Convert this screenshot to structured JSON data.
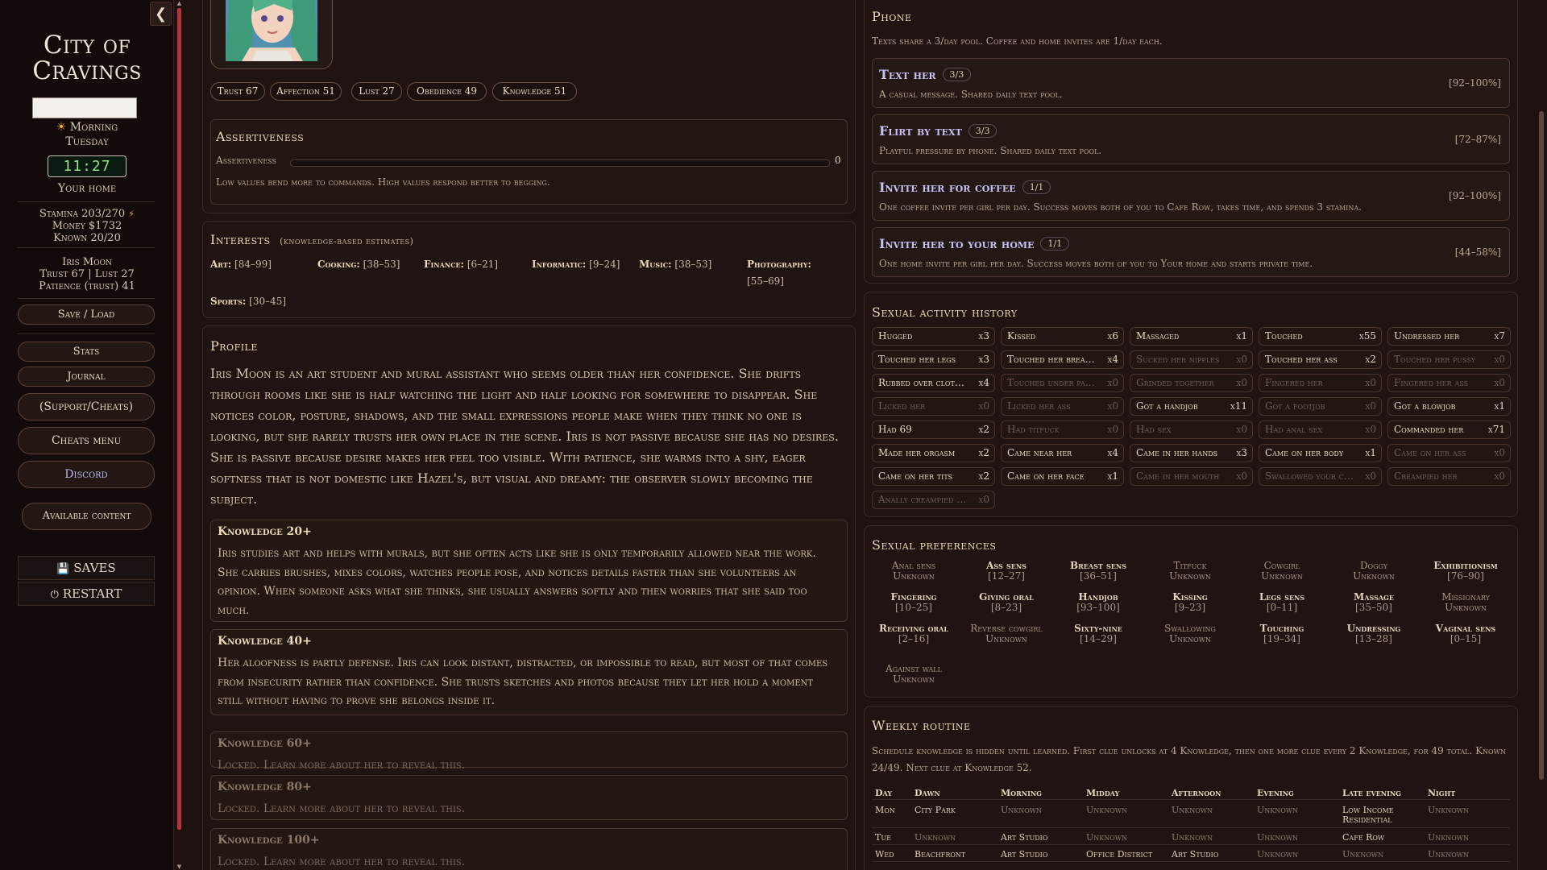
{
  "sidebar": {
    "title_line1": "City of",
    "title_line2": "Cravings",
    "time_of_day": "Morning",
    "day": "Tuesday",
    "clock": "11:27",
    "location": "Your home",
    "stamina": "Stamina 203/270",
    "money": "Money $1732",
    "known": "Known 20/20",
    "girl_name": "Iris Moon",
    "girl_trust_lust": "Trust 67 | Lust 27",
    "girl_patience": "Patience (trust) 41",
    "buttons": {
      "save_load": "Save / Load",
      "stats": "Stats",
      "journal": "Journal",
      "support": "(Support/Cheats)",
      "cheats": "Cheats menu",
      "discord": "Discord",
      "available": "Available content",
      "saves": "SAVES",
      "restart": "RESTART"
    }
  },
  "stats": {
    "trust": "Trust 67",
    "affection": "Affection 51",
    "lust": "Lust 27",
    "obedience": "Obedience 49",
    "knowledge": "Knowledge 51"
  },
  "assertiveness": {
    "title": "Assertiveness",
    "label": "Assertiveness",
    "value": "0",
    "level": 0,
    "desc": "Low values bend more to commands. High values respond better to begging."
  },
  "interests": {
    "title": "Interests",
    "subtitle": "(knowledge-based estimates)",
    "items": [
      {
        "name": "Art:",
        "range": "[84–99]"
      },
      {
        "name": "Cooking:",
        "range": "[38–53]"
      },
      {
        "name": "Finance:",
        "range": "[6–21]"
      },
      {
        "name": "Informatic:",
        "range": "[9–24]"
      },
      {
        "name": "Music:",
        "range": "[38–53]"
      },
      {
        "name": "Photography:",
        "range": "[55–69]"
      },
      {
        "name": "Sports:",
        "range": "[30–45]"
      }
    ]
  },
  "profile": {
    "title": "Profile",
    "text": "Iris Moon is an art student and mural assistant who seems older than her confidence. She drifts through rooms like she is half watching the light and half looking for somewhere to disappear. She notices color, posture, shadows, and the small expressions people make when they think no one is looking, but she rarely trusts her own place in the scene. Iris is not passive because she has no desires. She is passive because desire makes her feel too visible. With patience, she warms into a shy, eager softness that is not domestic like Hazel's, but visual and dreamy: the observer slowly becoming the subject.",
    "knowledge": [
      {
        "title": "Knowledge 20+",
        "text": "Iris studies art and helps with murals, but she often acts like she is only temporarily allowed near the work. She carries brushes, mixes colors, watches people pose, and notices details faster than she volunteers an opinion. When someone asks what she thinks, she usually answers softly and then worries that she said too much."
      },
      {
        "title": "Knowledge 40+",
        "text": "Her aloofness is partly defense. Iris can look distant, distracted, or impossible to read, but most of that comes from insecurity rather than confidence. She trusts sketches and photos because they let her hold a moment still without having to prove she belongs inside it."
      },
      {
        "title": "Knowledge 60+",
        "text": "Locked. Learn more about her to reveal this."
      },
      {
        "title": "Knowledge 80+",
        "text": "Locked. Learn more about her to reveal this."
      },
      {
        "title": "Knowledge 100+",
        "text": "Locked. Learn more about her to reveal this."
      }
    ]
  },
  "phone": {
    "title": "Phone",
    "note": "Texts share a 3/day pool. Coffee and home invites are 1/day each.",
    "actions": [
      {
        "title": "Text her",
        "count": "3/3",
        "desc": "A casual message. Shared daily text pool.",
        "range": "[92–100%]"
      },
      {
        "title": "Flirt by text",
        "count": "3/3",
        "desc": "Playful pressure by phone. Shared daily text pool.",
        "range": "[72–87%]"
      },
      {
        "title": "Invite her for coffee",
        "count": "1/1",
        "desc": "One coffee invite per girl per day. Success moves both of you to Cafe Row, takes time, and spends 3 stamina.",
        "range": "[92–100%]"
      },
      {
        "title": "Invite her to your home",
        "count": "1/1",
        "desc": "One home invite per girl per day. Success moves both of you to Your home and starts private time.",
        "range": "[44–58%]"
      }
    ]
  },
  "history": {
    "title": "Sexual activity history",
    "items": [
      {
        "label": "Hugged",
        "value": "x3"
      },
      {
        "label": "Kissed",
        "value": "x6"
      },
      {
        "label": "Massaged",
        "value": "x1"
      },
      {
        "label": "Touched",
        "value": "x55"
      },
      {
        "label": "Undressed her",
        "value": "x7"
      },
      {
        "label": "Touched her legs",
        "value": "x3"
      },
      {
        "label": "Touched her breasts",
        "value": "x4"
      },
      {
        "label": "Sucked her nipples",
        "value": "x0"
      },
      {
        "label": "Touched her ass",
        "value": "x2"
      },
      {
        "label": "Touched her pussy",
        "value": "x0"
      },
      {
        "label": "Rubbed over clothes",
        "value": "x4"
      },
      {
        "label": "Touched under panties",
        "value": "x0"
      },
      {
        "label": "Grinded together",
        "value": "x0"
      },
      {
        "label": "Fingered her",
        "value": "x0"
      },
      {
        "label": "Fingered her ass",
        "value": "x0"
      },
      {
        "label": "Licked her",
        "value": "x0"
      },
      {
        "label": "Licked her ass",
        "value": "x0"
      },
      {
        "label": "Got a handjob",
        "value": "x11"
      },
      {
        "label": "Got a footjob",
        "value": "x0"
      },
      {
        "label": "Got a blowjob",
        "value": "x1"
      },
      {
        "label": "Had 69",
        "value": "x2"
      },
      {
        "label": "Had titfuck",
        "value": "x0"
      },
      {
        "label": "Had sex",
        "value": "x0"
      },
      {
        "label": "Had anal sex",
        "value": "x0"
      },
      {
        "label": "Commanded her",
        "value": "x71"
      },
      {
        "label": "Made her orgasm",
        "value": "x2"
      },
      {
        "label": "Came near her",
        "value": "x4"
      },
      {
        "label": "Came in her hands",
        "value": "x3"
      },
      {
        "label": "Came on her body",
        "value": "x1"
      },
      {
        "label": "Came on her ass",
        "value": "x0"
      },
      {
        "label": "Came on her tits",
        "value": "x2"
      },
      {
        "label": "Came on her face",
        "value": "x1"
      },
      {
        "label": "Came in her mouth",
        "value": "x0"
      },
      {
        "label": "Swallowed your cum",
        "value": "x0"
      },
      {
        "label": "Creampied her",
        "value": "x0"
      },
      {
        "label": "Anally creampied her",
        "value": "x0"
      }
    ]
  },
  "preferences": {
    "title": "Sexual preferences",
    "items": [
      {
        "name": "Anal sens",
        "value": "Unknown"
      },
      {
        "name": "Ass sens",
        "value": "[12–27]"
      },
      {
        "name": "Breast sens",
        "value": "[36–51]"
      },
      {
        "name": "Titfuck",
        "value": "Unknown"
      },
      {
        "name": "Cowgirl",
        "value": "Unknown"
      },
      {
        "name": "Doggy",
        "value": "Unknown"
      },
      {
        "name": "Exhibitionism",
        "value": "[76–90]"
      },
      {
        "name": "Fingering",
        "value": "[10–25]"
      },
      {
        "name": "Giving oral",
        "value": "[8–23]"
      },
      {
        "name": "Handjob",
        "value": "[93–100]"
      },
      {
        "name": "Kissing",
        "value": "[9–23]"
      },
      {
        "name": "Legs sens",
        "value": "[0–11]"
      },
      {
        "name": "Massage",
        "value": "[35–50]"
      },
      {
        "name": "Missionary",
        "value": "Unknown"
      },
      {
        "name": "Receiving oral",
        "value": "[2–16]"
      },
      {
        "name": "Reverse cowgirl",
        "value": "Unknown"
      },
      {
        "name": "Sixty-nine",
        "value": "[14–29]"
      },
      {
        "name": "Swallowing",
        "value": "Unknown"
      },
      {
        "name": "Touching",
        "value": "[19–34]"
      },
      {
        "name": "Undressing",
        "value": "[13–28]"
      },
      {
        "name": "Vaginal sens",
        "value": "[0–15]"
      },
      {
        "name": "Against wall",
        "value": "Unknown"
      }
    ]
  },
  "routine": {
    "title": "Weekly routine",
    "note": "Schedule knowledge is hidden until learned. First clue unlocks at 4 Knowledge, then one more clue every 2 Knowledge, for 49 total. Known 24/49. Next clue at Knowledge 52.",
    "headers": [
      "Day",
      "Dawn",
      "Morning",
      "Midday",
      "Afternoon",
      "Evening",
      "Late evening",
      "Night"
    ],
    "rows": [
      [
        "Mon",
        "City Park",
        "Unknown",
        "Unknown",
        "Unknown",
        "Unknown",
        "Low Income Residential",
        "Unknown"
      ],
      [
        "Tue",
        "Unknown",
        "Art Studio",
        "Unknown",
        "Unknown",
        "Unknown",
        "Cafe Row",
        "Unknown"
      ],
      [
        "Wed",
        "Beachfront",
        "Art Studio",
        "Office District",
        "Art Studio",
        "Unknown",
        "Unknown",
        "Unknown"
      ]
    ]
  },
  "colors": {
    "background": "#1d1210",
    "accent_gold": "#ecd9b8",
    "action_purple": "#c8c2f4",
    "clock_green": "#8ee38c",
    "scroll_red": "#b8323c"
  },
  "icons": {
    "collapse": "chevron-left-icon",
    "time": "sun-icon",
    "stamina": "lightning-icon",
    "saves": "floppy-disk-icon",
    "restart": "power-icon"
  }
}
